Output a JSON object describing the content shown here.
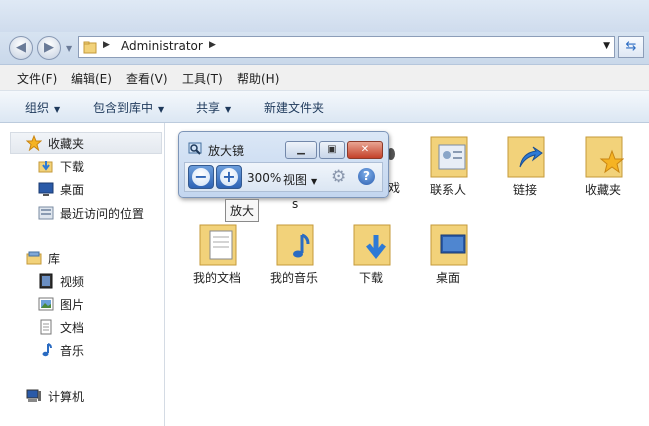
{
  "address": {
    "path": "Administrator"
  },
  "menu": [
    "文件(F)",
    "编辑(E)",
    "查看(V)",
    "工具(T)",
    "帮助(H)"
  ],
  "commands": [
    {
      "label": "组织",
      "dropdown": true
    },
    {
      "label": "包含到库中",
      "dropdown": true
    },
    {
      "label": "共享",
      "dropdown": true
    },
    {
      "label": "新建文件夹",
      "dropdown": false
    }
  ],
  "nav": {
    "favorites": {
      "label": "收藏夹",
      "items": [
        "下载",
        "桌面",
        "最近访问的位置"
      ]
    },
    "libraries": {
      "label": "库",
      "items": [
        "视频",
        "图片",
        "文档",
        "音乐"
      ]
    },
    "computer": {
      "label": "计算机"
    }
  },
  "files_row1": [
    "联系人",
    "链接",
    "收藏夹"
  ],
  "files_row2": [
    "我的文档",
    "我的音乐",
    "下载",
    "桌面"
  ],
  "partial_text": {
    "behind_left": "戏",
    "behind_below": "s"
  },
  "magnifier": {
    "title": "放大镜",
    "zoom": "300%",
    "view_label": "视图",
    "tooltip": "放大"
  },
  "colors": {
    "folder": "#f2d27a",
    "accent": "#2e63b5",
    "close": "#c4412a"
  }
}
